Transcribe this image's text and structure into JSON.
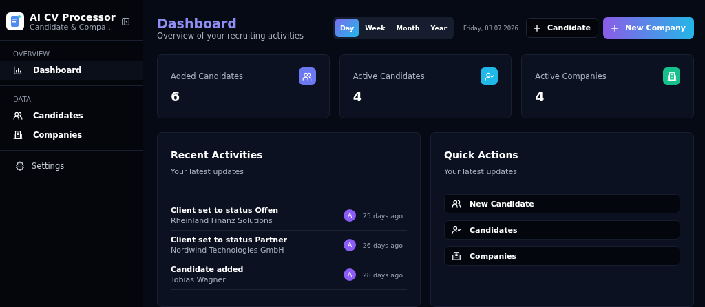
{
  "app": {
    "title": "AI CV Processor",
    "subtitle": "Candidate & Compa..."
  },
  "sidebar": {
    "sections": [
      {
        "heading": "OVERVIEW",
        "items": [
          {
            "label": "Dashboard",
            "kind": "chart",
            "selected": true
          }
        ]
      },
      {
        "heading": "DATA",
        "items": [
          {
            "label": "Candidates",
            "kind": "users",
            "selected": false
          },
          {
            "label": "Companies",
            "kind": "building",
            "selected": false
          }
        ]
      }
    ],
    "footer_items": [
      {
        "label": "Settings",
        "kind": "gear"
      }
    ]
  },
  "header": {
    "title": "Dashboard",
    "subtitle": "Overview of your recruiting activities",
    "ranges": [
      {
        "label": "Day",
        "selected": true
      },
      {
        "label": "Week",
        "selected": false
      },
      {
        "label": "Month",
        "selected": false
      },
      {
        "label": "Year",
        "selected": false
      }
    ],
    "date": "Friday, 03.07.2026",
    "buttons": [
      {
        "label": "Candidate",
        "kind": "outline"
      },
      {
        "label": "New Company",
        "kind": "primary"
      }
    ]
  },
  "stats": [
    {
      "label": "Added Candidates",
      "value": "6",
      "kind": "users",
      "color": "#6b78f0"
    },
    {
      "label": "Active Candidates",
      "value": "4",
      "kind": "user-check",
      "color": "#1fb8e8"
    },
    {
      "label": "Active Companies",
      "value": "4",
      "kind": "building",
      "color": "#16c08a"
    }
  ],
  "recent_activities": {
    "title": "Recent Activities",
    "subtitle": "Your latest updates",
    "items": [
      {
        "title": "Client set to status Offen",
        "detail": "Rheinland Finanz Solutions",
        "avatar": "A",
        "time": "25 days ago"
      },
      {
        "title": "Client set to status Partner",
        "detail": "Nordwind Technologies GmbH",
        "avatar": "A",
        "time": "26 days ago"
      },
      {
        "title": "Candidate added",
        "detail": "Tobias Wagner",
        "avatar": "A",
        "time": "28 days ago"
      }
    ]
  },
  "quick_actions": {
    "title": "Quick Actions",
    "subtitle": "Your latest updates",
    "items": [
      {
        "label": "New Candidate",
        "kind": "users"
      },
      {
        "label": "Candidates",
        "kind": "user-check"
      },
      {
        "label": "Companies",
        "kind": "building"
      }
    ]
  }
}
